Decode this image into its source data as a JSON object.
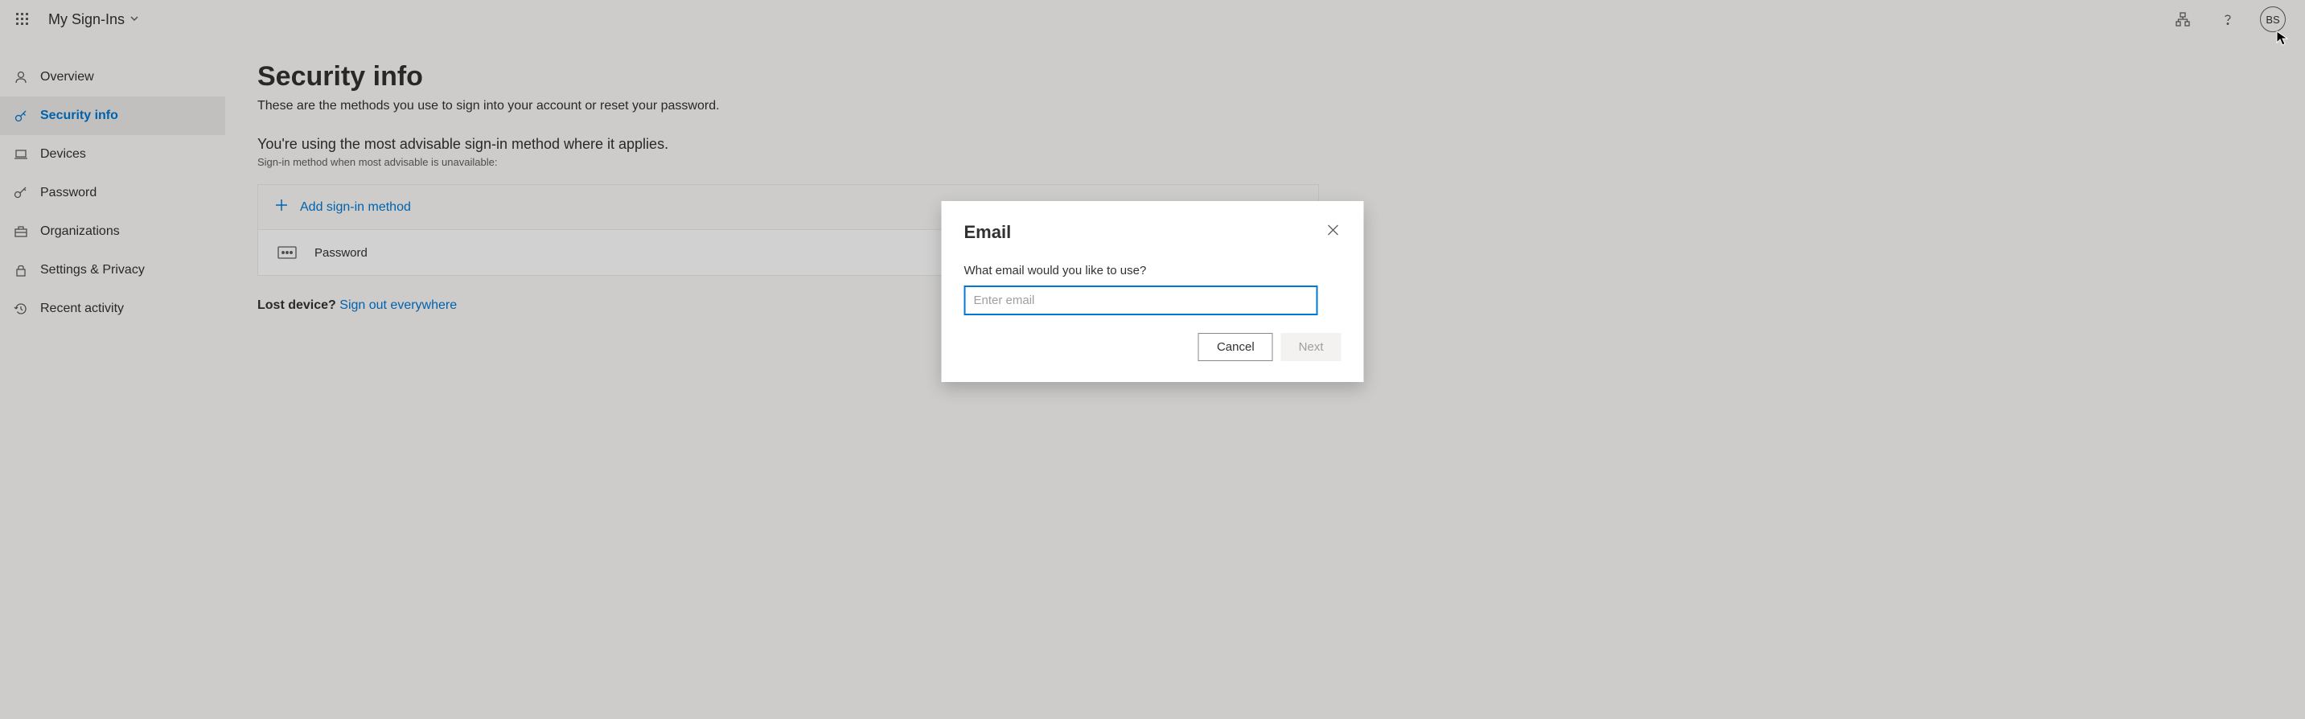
{
  "header": {
    "app_title": "My Sign-Ins",
    "avatar_initials": "BS"
  },
  "sidebar": {
    "items": [
      {
        "label": "Overview"
      },
      {
        "label": "Security info"
      },
      {
        "label": "Devices"
      },
      {
        "label": "Password"
      },
      {
        "label": "Organizations"
      },
      {
        "label": "Settings & Privacy"
      },
      {
        "label": "Recent activity"
      }
    ]
  },
  "content": {
    "title": "Security info",
    "subtitle": "These are the methods you use to sign into your account or reset your password.",
    "advisable": "You're using the most advisable sign-in method where it applies.",
    "advisable_sub": "Sign-in method when most advisable is unavailable:",
    "add_method_label": "Add sign-in method",
    "methods": [
      {
        "label": "Password"
      }
    ],
    "lost_device_label": "Lost device?",
    "sign_out_label": "Sign out everywhere"
  },
  "dialog": {
    "title": "Email",
    "label": "What email would you like to use?",
    "placeholder": "Enter email",
    "cancel_label": "Cancel",
    "next_label": "Next"
  }
}
